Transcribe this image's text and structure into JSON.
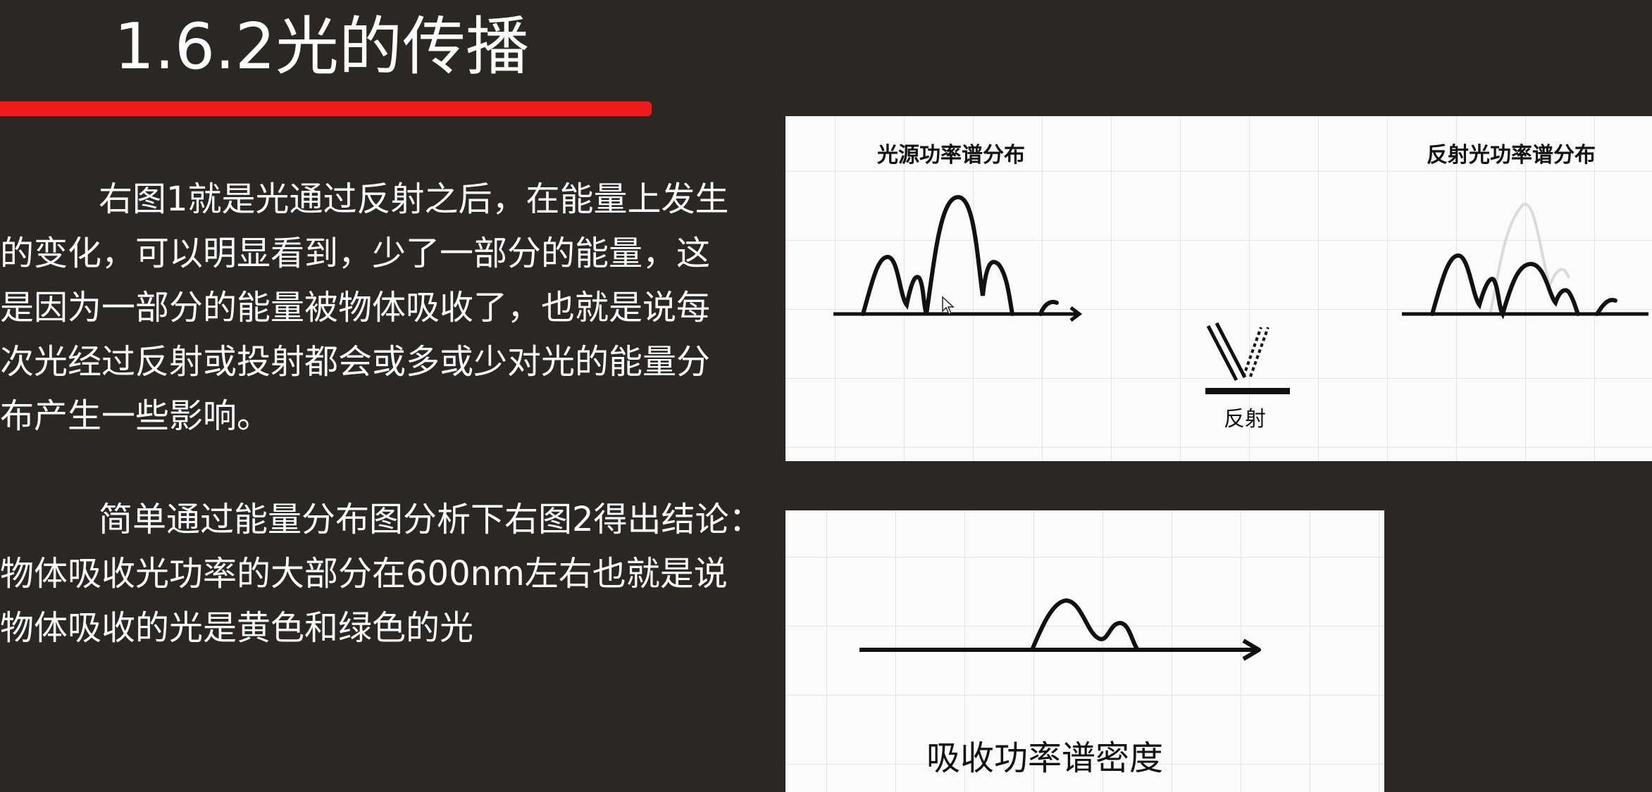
{
  "slide": {
    "title": "1.6.2光的传播"
  },
  "paragraph1": {
    "lines": [
      "右图1就是光通过反射之后，在能量上发生",
      "的变化，可以明显看到，少了一部分的能量，这",
      "是因为一部分的能量被物体吸收了，也就是说每",
      "次光经过反射或投射都会或多或少对光的能量分",
      "布产生一些影响。"
    ]
  },
  "paragraph2": {
    "lines": [
      "简单通过能量分布图分析下右图2得出结论：",
      "物体吸收光功率的大部分在600nm左右也就是说",
      "物体吸收的光是黄色和绿色的光"
    ]
  },
  "figure1": {
    "left_label": "光源功率谱分布",
    "right_label": "反射光功率谱分布",
    "center_label": "反射"
  },
  "figure2": {
    "bottom_label": "吸收功率谱密度"
  },
  "colors": {
    "background": "#2b2823",
    "accent_bar": "#ee1c1c",
    "text": "#ffffff"
  }
}
